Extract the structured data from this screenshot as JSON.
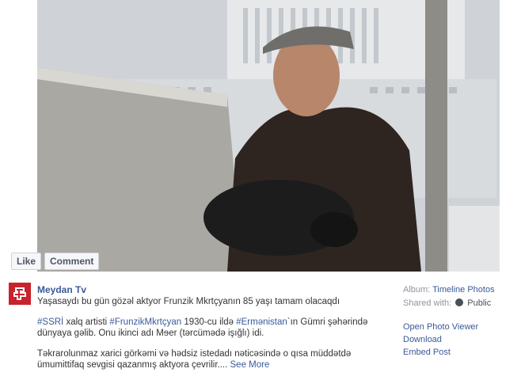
{
  "photo": {
    "actions": {
      "like_label": "Like",
      "comment_label": "Comment"
    }
  },
  "post": {
    "page_name": "Meydan Tv",
    "line1": "Yaşasaydı bu gün gözəl aktyor Frunzik Mkrtçyanın 85 yaşı tamam olacaqdı",
    "tag_ussr": "#SSRİ",
    "text_xalq": " xalq artisti ",
    "tag_frunzik": "#FrunzikMkrtçyan",
    "text_born": " 1930-cu ildə ",
    "tag_armenia": "#Ermənistan",
    "text_gumri": "`ın Gümri şəhərində",
    "line3": "dünyaya gəlib. Onu ikinci adı Mɘer (tərcümədə işığlı) idi.",
    "line4": "Təkrarolunmaz xarici görkəmi və hədsiz istedadı nəticəsində o qısa müddətdə",
    "line5": "ümumittifaq sevgisi qazanmış aktyora çevrilir....",
    "see_more": "See More"
  },
  "sidebar": {
    "album_label": "Album:",
    "album_link": "Timeline Photos",
    "shared_label": "Shared with:",
    "shared_value": "Public",
    "actions": [
      "Open Photo Viewer",
      "Download",
      "Embed Post"
    ]
  }
}
